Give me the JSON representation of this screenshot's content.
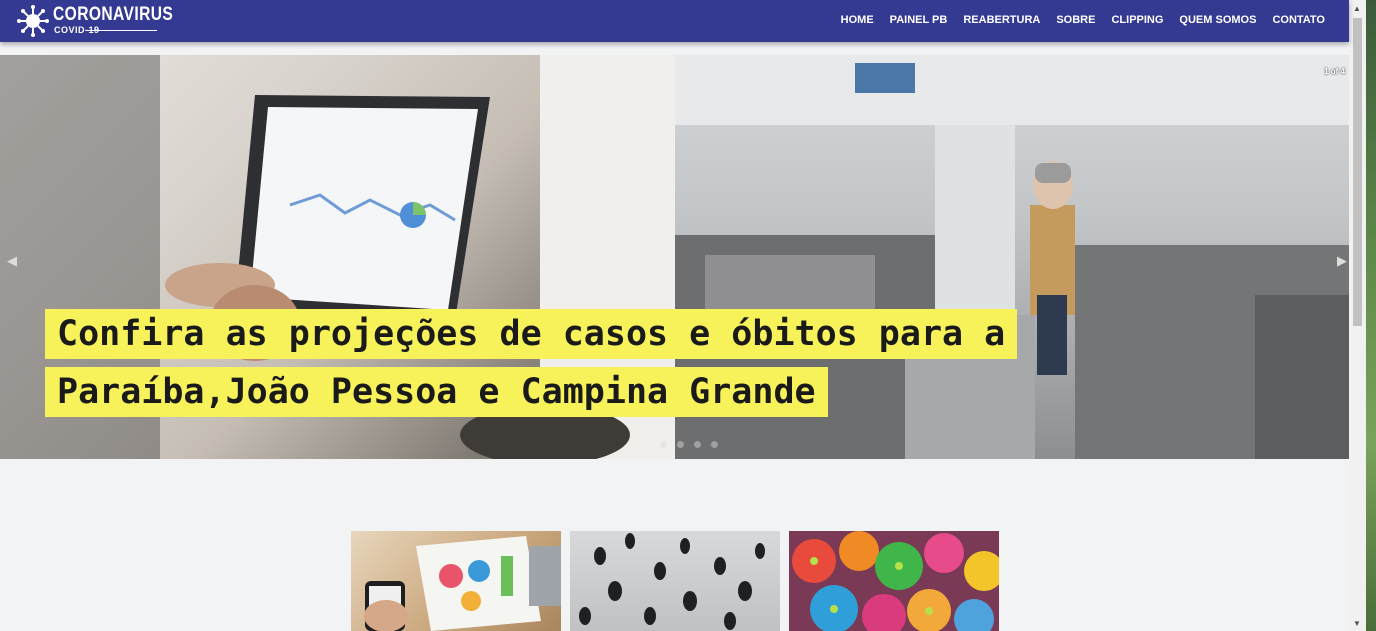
{
  "brand": {
    "name": "CORONAVIRUS",
    "subtitle": "COVID-19"
  },
  "nav": {
    "items": [
      "HOME",
      "PAINEL PB",
      "REABERTURA",
      "SOBRE",
      "CLIPPING",
      "QUEM SOMOS",
      "CONTATO"
    ]
  },
  "slider": {
    "counter": "1 of 4",
    "caption": [
      "Confira as projeções de casos e óbitos para a",
      "Paraíba,João Pessoa e Campina Grande"
    ],
    "prev_glyph": "◀",
    "next_glyph": "▶",
    "slide_count": 4,
    "active_slide": 1
  },
  "colors": {
    "nav": "#343a91",
    "caption_bg": "#f7f25a",
    "page_bg": "#f2f3f5"
  },
  "icons": {
    "logo": "virus-icon",
    "prev": "chevron-left-icon",
    "next": "chevron-right-icon"
  }
}
